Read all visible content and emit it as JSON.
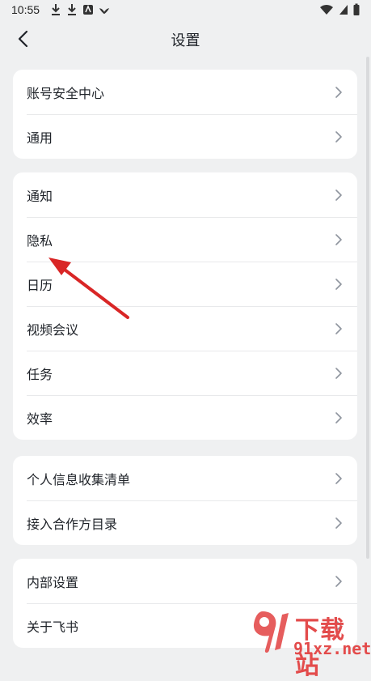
{
  "status_bar": {
    "time": "10:55"
  },
  "header": {
    "title": "设置"
  },
  "groups": [
    {
      "items": [
        {
          "label": "账号安全中心"
        },
        {
          "label": "通用"
        }
      ]
    },
    {
      "items": [
        {
          "label": "通知"
        },
        {
          "label": "隐私"
        },
        {
          "label": "日历"
        },
        {
          "label": "视频会议"
        },
        {
          "label": "任务"
        },
        {
          "label": "效率"
        }
      ]
    },
    {
      "items": [
        {
          "label": "个人信息收集清单"
        },
        {
          "label": "接入合作方目录"
        }
      ]
    },
    {
      "items": [
        {
          "label": "内部设置"
        },
        {
          "label": "关于飞书"
        }
      ]
    }
  ],
  "watermark": {
    "site_name": "下载站",
    "domain": "91xz.net"
  },
  "colors": {
    "background": "#eff0f1",
    "card": "#ffffff",
    "annotation_arrow": "#d92626",
    "watermark": "#e34b4b"
  },
  "icons": {
    "back": "chevron-left-icon",
    "row_chevron": "chevron-right-icon"
  }
}
